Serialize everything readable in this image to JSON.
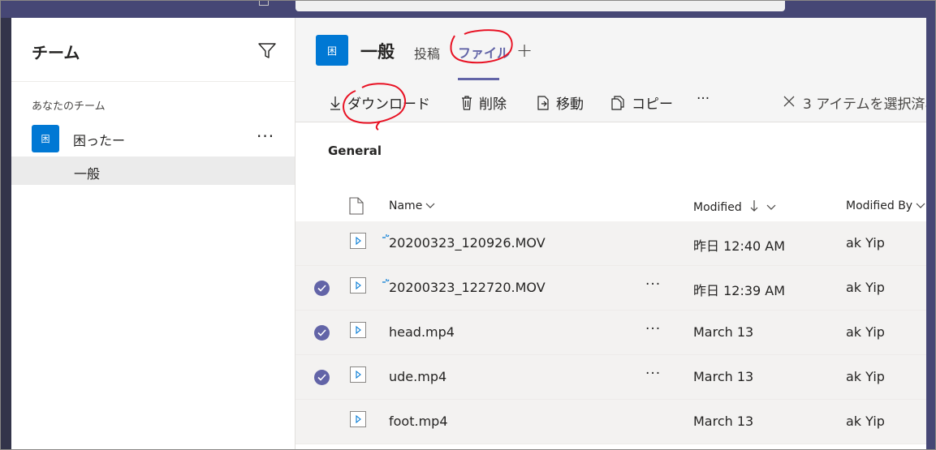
{
  "sidebar": {
    "title": "チーム",
    "section_label": "あなたのチーム",
    "team": {
      "avatar": "困",
      "name": "困ったー",
      "more": "···"
    },
    "channel": {
      "name": "一般"
    }
  },
  "header": {
    "avatar": "困",
    "title": "一般",
    "tabs": [
      {
        "label": "投稿"
      },
      {
        "label": "ファイル"
      }
    ],
    "add": "+"
  },
  "toolbar": {
    "download": "ダウンロード",
    "delete": "削除",
    "move": "移動",
    "copy": "コピー",
    "more": "···",
    "selection_status": "3 アイテムを選択済み"
  },
  "files": {
    "group_title": "General",
    "columns": {
      "name": "Name",
      "modified": "Modified",
      "modified_by": "Modified By"
    },
    "rows": [
      {
        "name": "20200323_120926.MOV",
        "modified": "昨日 12:40 AM",
        "modified_by": "ak Yip",
        "selected": false
      },
      {
        "name": "20200323_122720.MOV",
        "modified": "昨日 12:39 AM",
        "modified_by": "ak Yip",
        "selected": true
      },
      {
        "name": "head.mp4",
        "modified": "March 13",
        "modified_by": "ak Yip",
        "selected": true
      },
      {
        "name": "ude.mp4",
        "modified": "March 13",
        "modified_by": "ak Yip",
        "selected": true
      },
      {
        "name": "foot.mp4",
        "modified": "March 13",
        "modified_by": "ak Yip",
        "selected": false
      }
    ],
    "row_more": "···"
  },
  "colors": {
    "accent": "#6264a7",
    "brand_blue": "#0078d4",
    "topbar": "#464775",
    "annotation": "#e81123"
  },
  "icons": [
    "filter-icon",
    "download-icon",
    "trash-icon",
    "move-icon",
    "copy-icon",
    "close-icon",
    "file-icon",
    "video-file-icon",
    "checkmark-icon",
    "chevron-down-icon",
    "arrow-down-icon",
    "sync-icon"
  ]
}
